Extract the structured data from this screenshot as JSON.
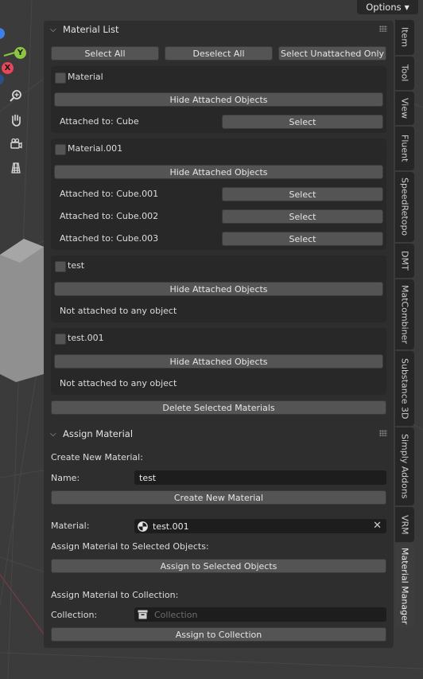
{
  "header": {
    "options_label": "Options"
  },
  "viewport": {
    "axes": {
      "y": "Y",
      "x": "X"
    },
    "tools": [
      "zoom-icon",
      "hand-icon",
      "camera-icon",
      "grid-icon"
    ]
  },
  "material_list": {
    "title": "Material List",
    "select_all": "Select All",
    "deselect_all": "Deselect All",
    "select_unattached": "Select Unattached Only",
    "materials": [
      {
        "name": "Material",
        "hide_label": "Hide Attached Objects",
        "attachments": [
          {
            "text": "Attached to: Cube",
            "select_label": "Select"
          }
        ]
      },
      {
        "name": "Material.001",
        "hide_label": "Hide Attached Objects",
        "attachments": [
          {
            "text": "Attached to: Cube.001",
            "select_label": "Select"
          },
          {
            "text": "Attached to: Cube.002",
            "select_label": "Select"
          },
          {
            "text": "Attached to: Cube.003",
            "select_label": "Select"
          }
        ]
      },
      {
        "name": "test",
        "hide_label": "Hide Attached Objects",
        "note": "Not attached to any object"
      },
      {
        "name": "test.001",
        "hide_label": "Hide Attached Objects",
        "note": "Not attached to any object"
      }
    ],
    "delete_selected": "Delete Selected Materials"
  },
  "assign_material": {
    "title": "Assign Material",
    "create_heading": "Create New Material:",
    "name_label": "Name:",
    "name_value": "test",
    "create_button": "Create New Material",
    "material_label": "Material:",
    "material_value": "test.001",
    "assign_selected_heading": "Assign Material to Selected Objects:",
    "assign_selected_button": "Assign to Selected Objects",
    "assign_collection_heading": "Assign Material to Collection:",
    "collection_label": "Collection:",
    "collection_placeholder": "Collection",
    "assign_collection_button": "Assign to Collection"
  },
  "tabs": [
    {
      "label": "Item"
    },
    {
      "label": "Tool"
    },
    {
      "label": "View"
    },
    {
      "label": "Fluent"
    },
    {
      "label": "SpeedRetopo"
    },
    {
      "label": "DMT"
    },
    {
      "label": "MatCombiner"
    },
    {
      "label": "Substance 3D"
    },
    {
      "label": "Simply Addons"
    },
    {
      "label": "VRM"
    },
    {
      "label": "Material Manager",
      "active": true
    }
  ],
  "colors": {
    "accent_y": "#8cc63f",
    "accent_x": "#e8465a",
    "accent_z": "#3f7fe8"
  }
}
